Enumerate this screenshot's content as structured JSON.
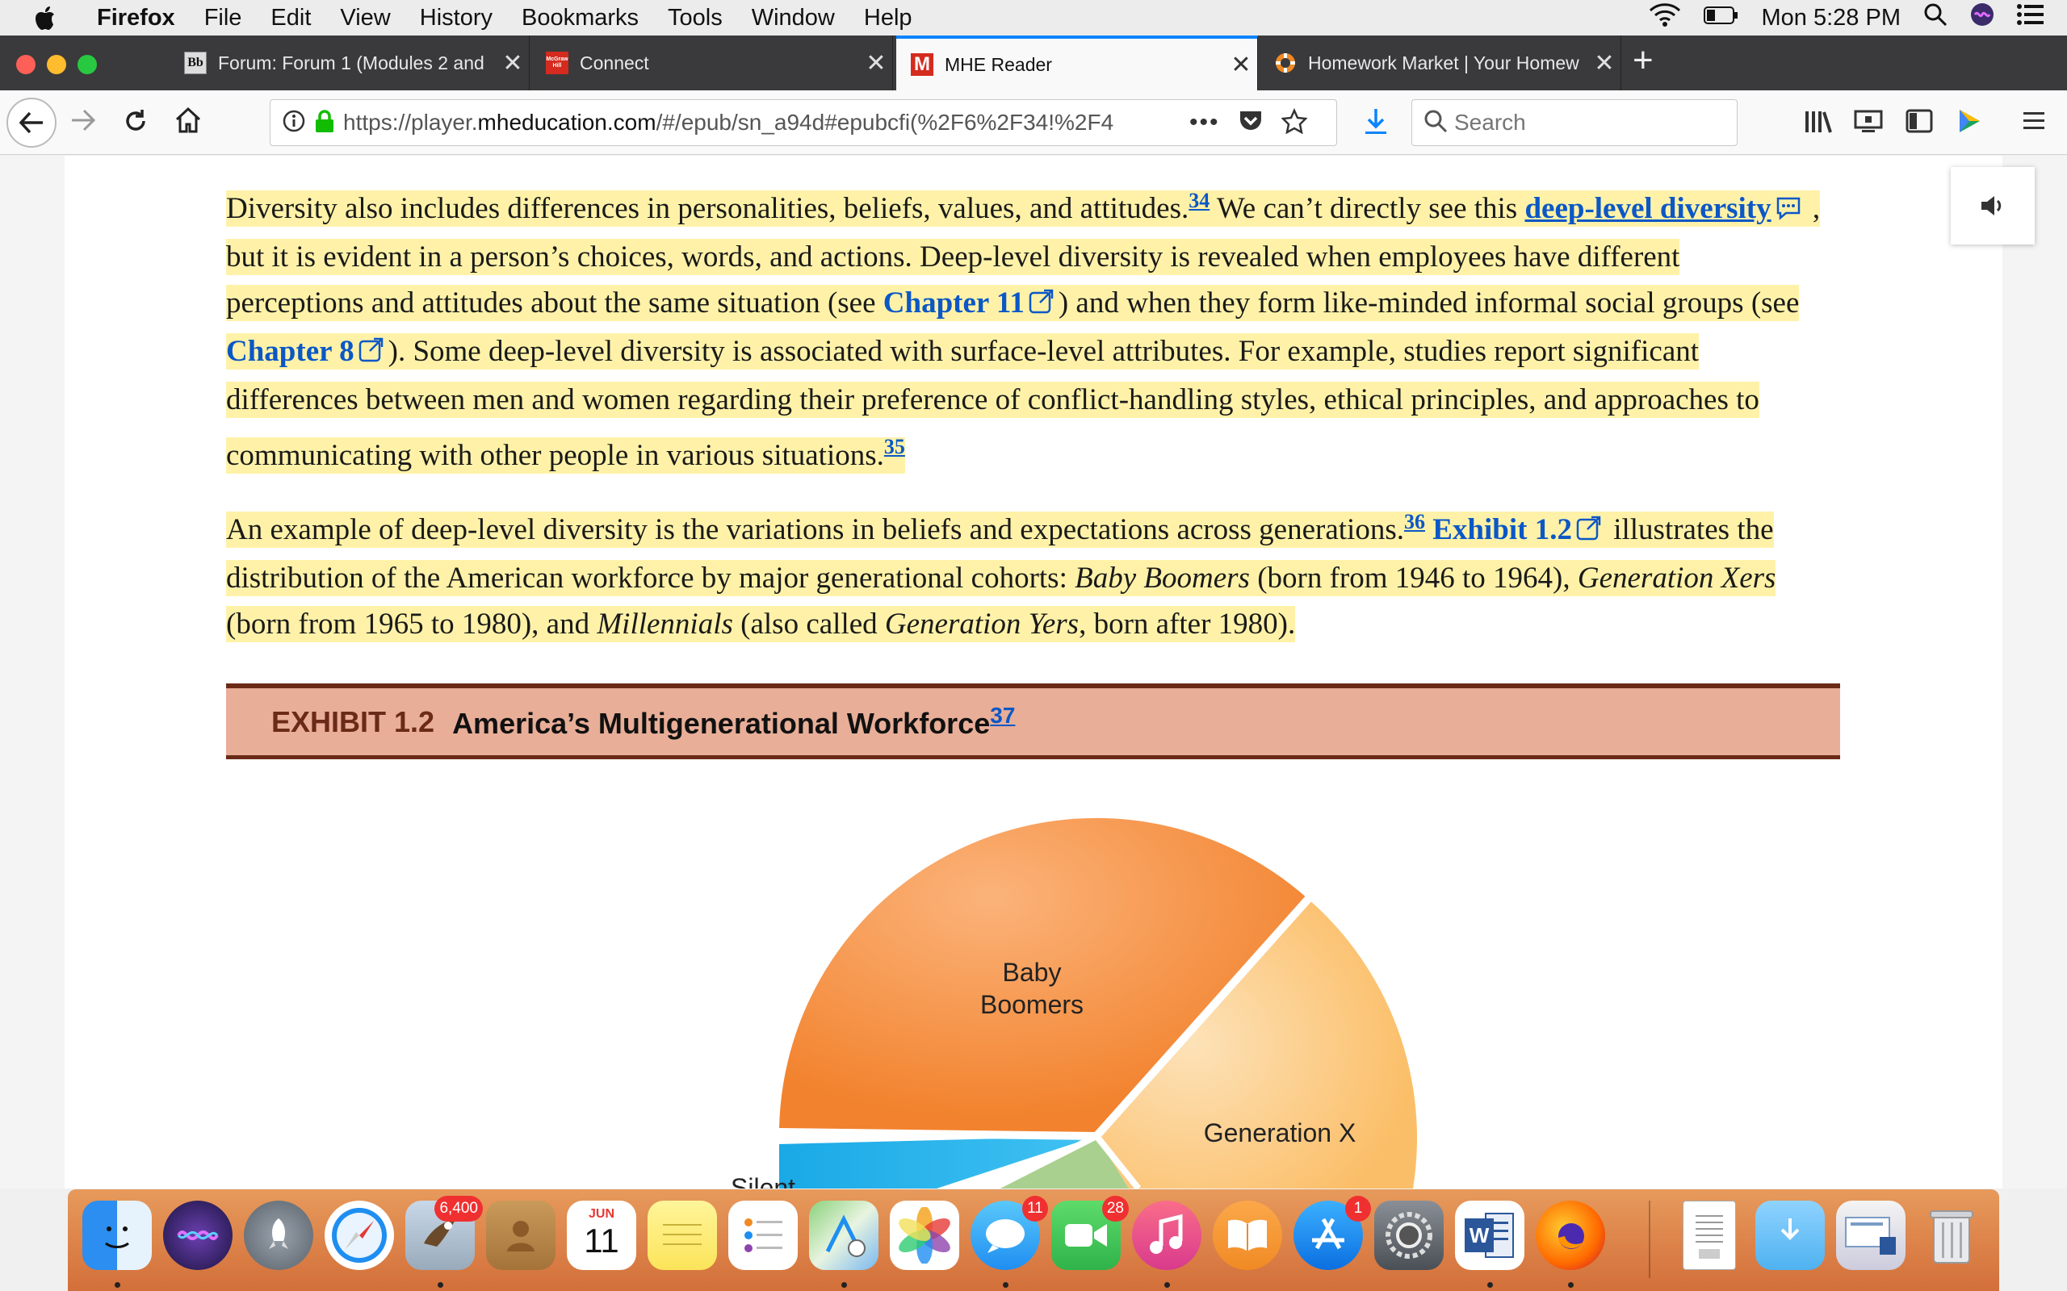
{
  "menubar": {
    "app": "Firefox",
    "items": [
      "File",
      "Edit",
      "View",
      "History",
      "Bookmarks",
      "Tools",
      "Window",
      "Help"
    ],
    "clock": "Mon 5:28 PM"
  },
  "tabs": [
    {
      "title": "Forum: Forum 1 (Modules 2 and",
      "favicon": "Bb"
    },
    {
      "title": "Connect",
      "favicon": "McGraw Hill"
    },
    {
      "title": "MHE Reader",
      "favicon": "M"
    },
    {
      "title": "Homework Market | Your Homew",
      "favicon": "lifebuoy-icon"
    }
  ],
  "navbar": {
    "url_prefix": "https://player.",
    "url_domain": "mheducation.com",
    "url_rest": "/#/epub/sn_a94d#epubcfi(%2F6%2F34!%2F4",
    "search_placeholder": "Search"
  },
  "article": {
    "p1": {
      "t1": "Diversity also includes differences in personalities, beliefs, values, and attitudes.",
      "ref34": "34",
      "t2": " We can’t directly see this ",
      "kw1": "deep-level diversity",
      "t3": " , but it is evident in a person’s choices, words, and actions. Deep-level diversity is revealed when employees have different perceptions and attitudes about the same situation (see ",
      "ch11": "Chapter 11",
      "t4": ") and when they form like-minded informal social groups (see ",
      "ch8": "Chapter 8",
      "t5": "). Some deep-level diversity is associated with surface-level attributes. For example, studies report significant differences between men and women regarding their preference of conflict-handling styles, ethical principles, and approaches to communicating with other people in various situations.",
      "ref35": "35"
    },
    "p2": {
      "t1": "An example of deep-level diversity is the variations in beliefs and expectations across generations.",
      "ref36": "36",
      "ex12": "Exhibit 1.2",
      "t2": " illustrates the distribution of the American workforce by major generational cohorts: ",
      "bb": "Baby Boomers",
      "t3": " (born from 1946 to 1964), ",
      "gx": "Generation Xers",
      "t4": " (born from 1965 to 1980), and ",
      "mil": "Millennials",
      "t5": " (also called ",
      "gy": "Generation Yers",
      "t6": ", born after 1980)."
    },
    "exhibit": {
      "number": "EXHIBIT 1.2",
      "title": "America’s Multigenerational Workforce",
      "ref": "37"
    },
    "pie_labels": {
      "baby_boomers_1": "Baby",
      "baby_boomers_2": "Boomers",
      "gen_x": "Generation X",
      "partial": "Silent"
    }
  },
  "dock": {
    "badges": {
      "mail": "6,400",
      "calendar_month": "JUN",
      "calendar_day": "11",
      "messages": "11",
      "facetime": "28",
      "appstore": "1"
    }
  }
}
